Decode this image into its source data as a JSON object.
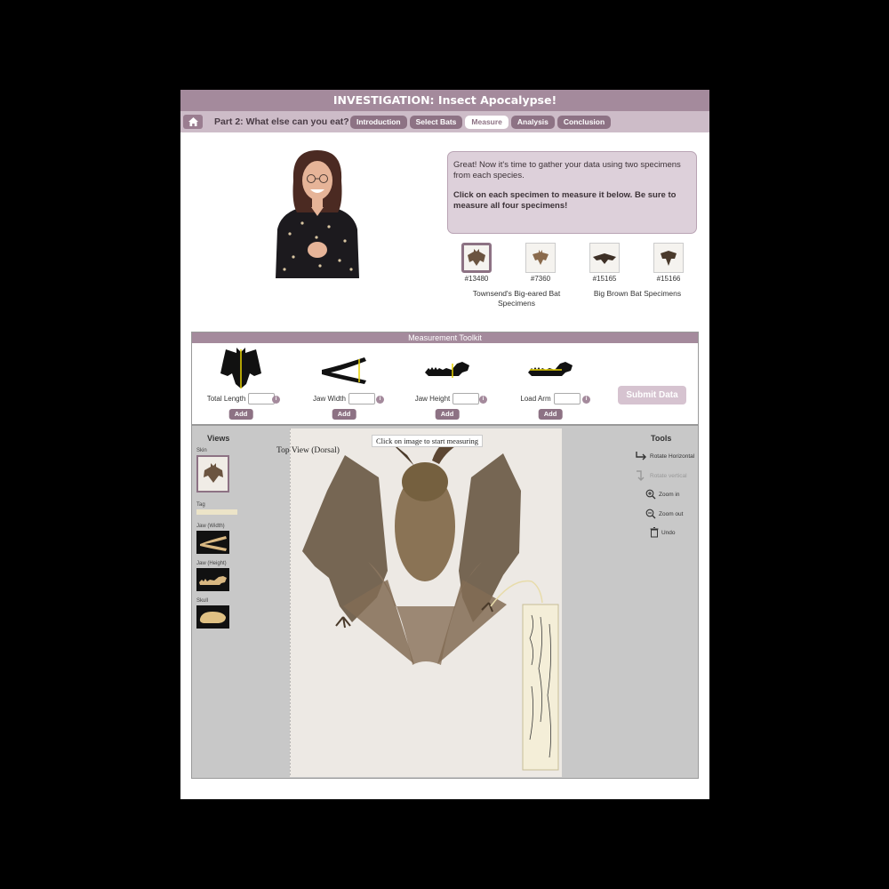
{
  "app": {
    "title": "INVESTIGATION: Insect Apocalypse!",
    "part_title": "Part 2: What else can you eat?",
    "tabs": [
      {
        "label": "Introduction",
        "active": false
      },
      {
        "label": "Select Bats",
        "active": false
      },
      {
        "label": "Measure",
        "active": true
      },
      {
        "label": "Analysis",
        "active": false
      },
      {
        "label": "Conclusion",
        "active": false
      }
    ],
    "home_icon": "home-icon",
    "accent": "#8d7284"
  },
  "speech": {
    "line1": "Great! Now it's time to gather your data using two specimens from each species.",
    "line2": "Click on each specimen to measure it below. Be sure to measure all four specimens!"
  },
  "specimens": {
    "items": [
      {
        "number": "#13480",
        "selected": true
      },
      {
        "number": "#7360",
        "selected": false
      },
      {
        "number": "#15165",
        "selected": false
      },
      {
        "number": "#15166",
        "selected": false
      }
    ],
    "group1": "Townsend's Big-eared Bat Specimens",
    "group2": "Big Brown Bat Specimens"
  },
  "toolkit": {
    "title": "Measurement Toolkit",
    "measurements": [
      {
        "label": "Total Length",
        "value": "",
        "add": "Add"
      },
      {
        "label": "Jaw Width",
        "value": "",
        "add": "Add"
      },
      {
        "label": "Jaw Height",
        "value": "",
        "add": "Add"
      },
      {
        "label": "Load Arm",
        "value": "",
        "add": "Add"
      }
    ],
    "info_glyph": "i",
    "submit": "Submit Data"
  },
  "views": {
    "title": "Views",
    "items": [
      "Skin",
      "Tag",
      "Jaw (Width)",
      "Jaw (Height)",
      "Skull"
    ]
  },
  "stage": {
    "hint": "Click on image to start measuring",
    "view_label": "Top View (Dorsal)"
  },
  "tools": {
    "title": "Tools",
    "items": [
      {
        "label": "Rotate Horizontal",
        "icon": "rotate-horizontal-icon",
        "enabled": true
      },
      {
        "label": "Rotate vertical",
        "icon": "rotate-vertical-icon",
        "enabled": false
      },
      {
        "label": "Zoom in",
        "icon": "zoom-in-icon",
        "enabled": true
      },
      {
        "label": "Zoom out",
        "icon": "zoom-out-icon",
        "enabled": true
      },
      {
        "label": "Undo",
        "icon": "undo-icon",
        "enabled": true
      }
    ]
  }
}
